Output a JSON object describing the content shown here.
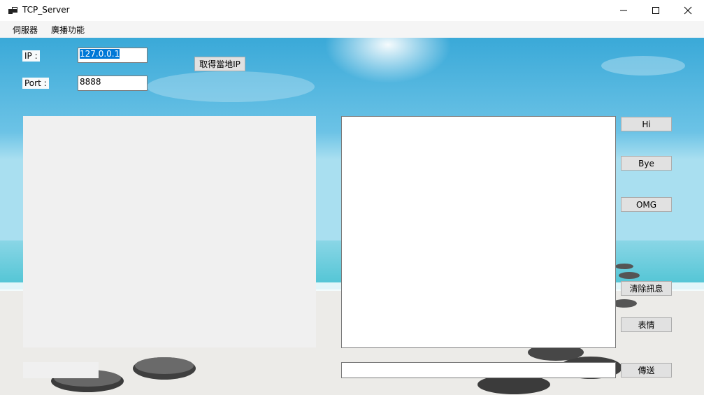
{
  "window": {
    "title": "TCP_Server",
    "icon": "app-window-icon",
    "controls": {
      "minimize_icon": "minimize-icon",
      "maximize_icon": "maximize-icon",
      "close_icon": "close-icon"
    }
  },
  "menu": {
    "items": [
      "伺服器",
      "廣播功能"
    ]
  },
  "form": {
    "ip_label": "IP :",
    "ip_value": "127.0.0.1",
    "port_label": "Port :",
    "port_value": "8888",
    "get_ip_button": "取得當地IP"
  },
  "side_buttons": {
    "hi": "Hi",
    "bye": "Bye",
    "omg": "OMG",
    "clear": "清除訊息",
    "emoji": "表情",
    "send": "傳送"
  },
  "message_input": {
    "value": ""
  },
  "status_box": {
    "value": ""
  },
  "colors": {
    "sky_top": "#3aa9d8",
    "sky_mid": "#8ad0ea",
    "sea": "#6fd0dc",
    "sand": "#ecebe8",
    "selection": "#0078d7"
  }
}
